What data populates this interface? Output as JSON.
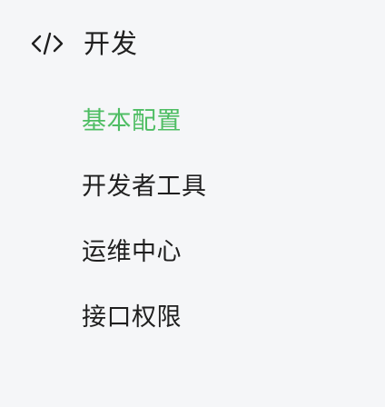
{
  "section": {
    "icon": "code-icon",
    "title": "开发"
  },
  "menu": {
    "items": [
      {
        "label": "基本配置",
        "active": true
      },
      {
        "label": "开发者工具",
        "active": false
      },
      {
        "label": "运维中心",
        "active": false
      },
      {
        "label": "接口权限",
        "active": false
      }
    ]
  },
  "colors": {
    "background": "#f5f6f8",
    "text": "#1f1f1f",
    "active": "#4ebd63"
  }
}
